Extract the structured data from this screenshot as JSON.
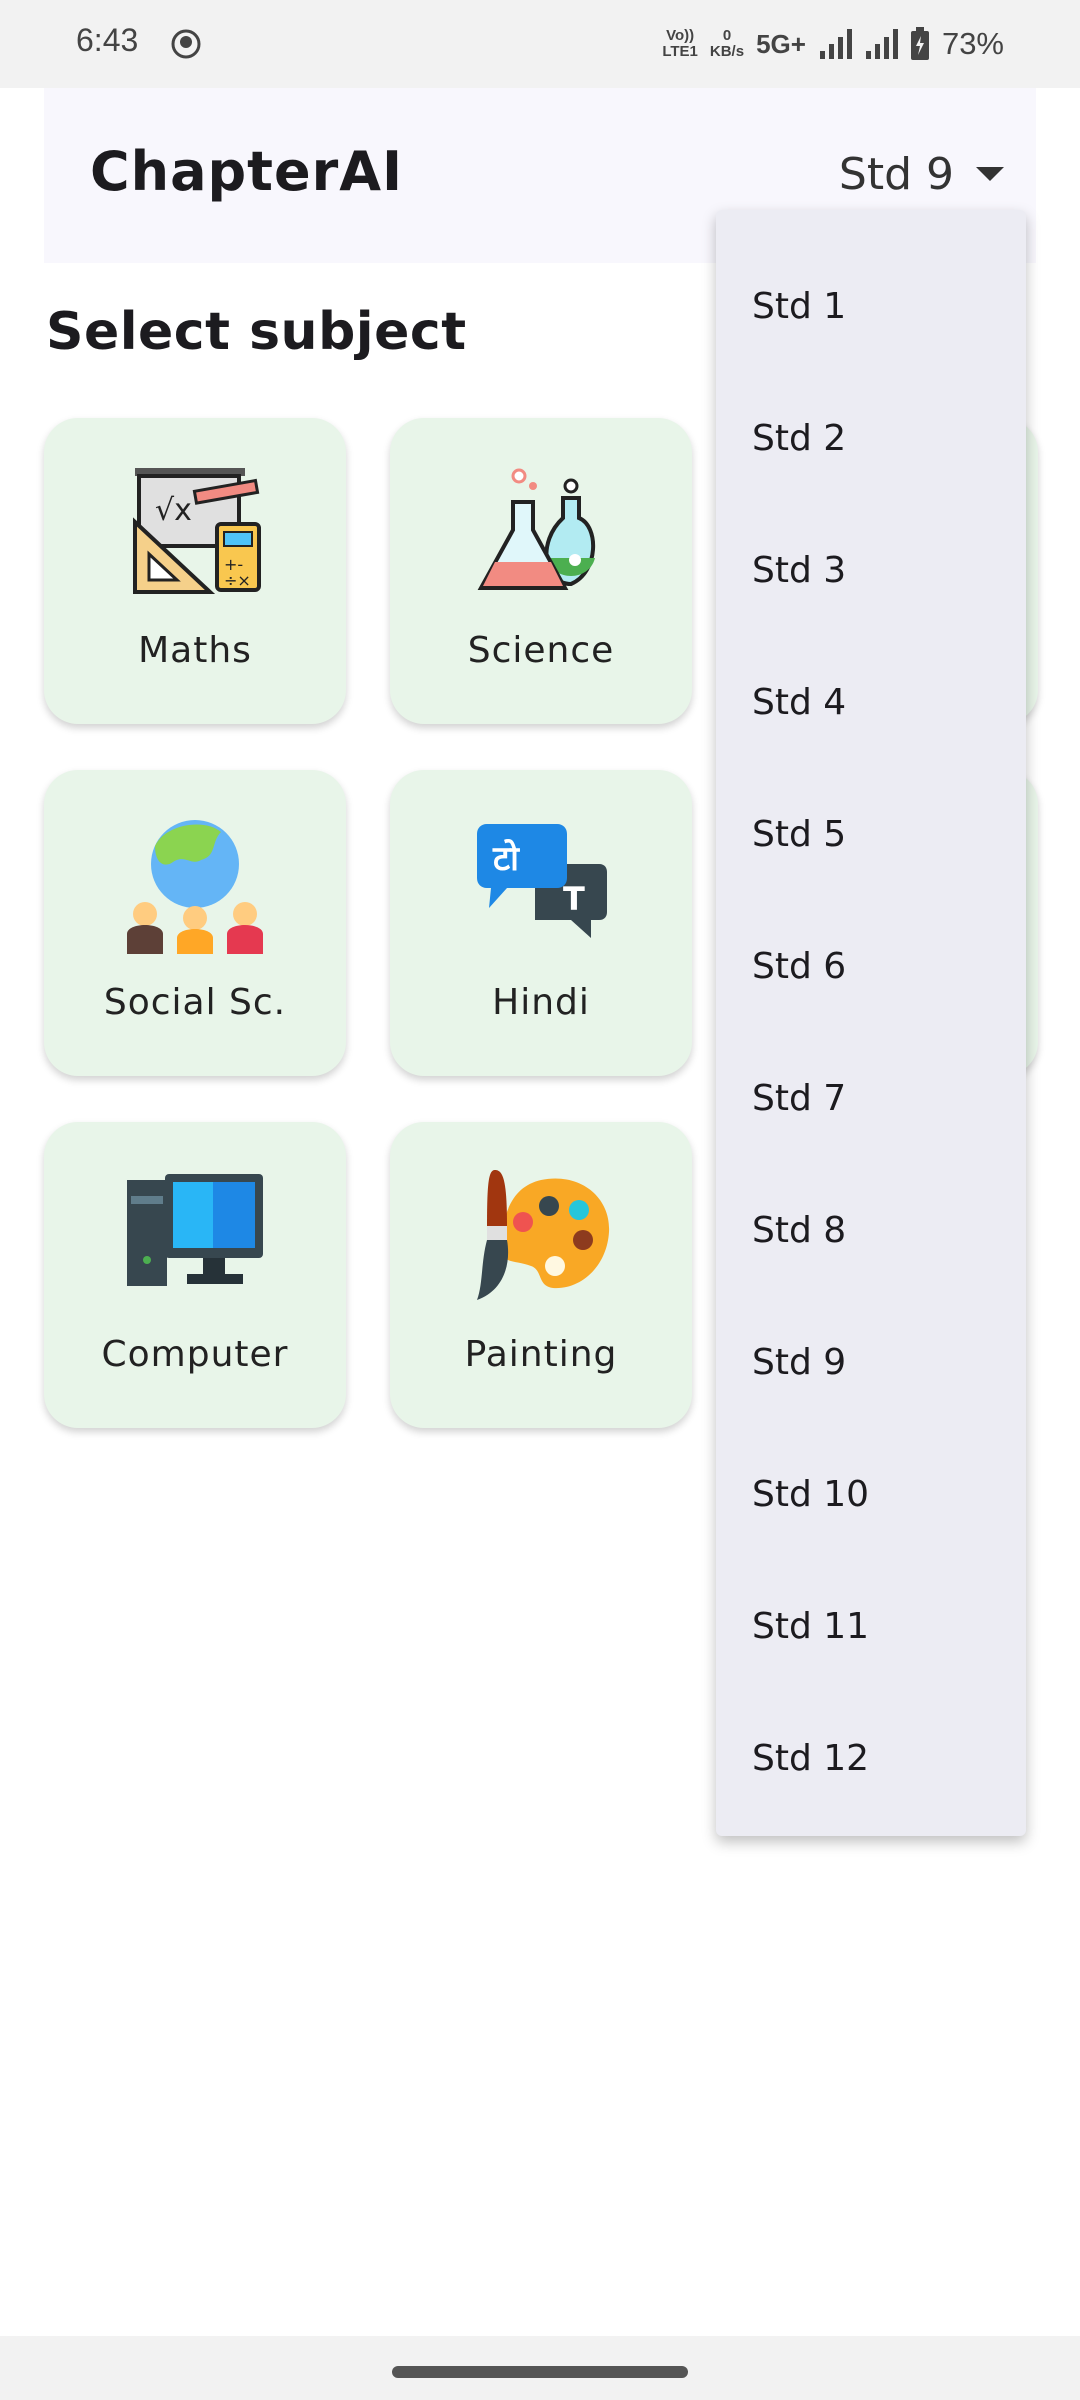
{
  "status_bar": {
    "time": "6:43",
    "volte": "Vo))",
    "lte": "LTE1",
    "speed_value": "0",
    "speed_unit": "KB/s",
    "network": "5G+",
    "battery": "73%"
  },
  "app_bar": {
    "title": "ChapterAI",
    "selected_std": "Std 9"
  },
  "section_title": "Select subject",
  "subjects": [
    {
      "label": "Maths",
      "icon": "maths-icon"
    },
    {
      "label": "Science",
      "icon": "science-icon"
    },
    {
      "label": "Social Sc.",
      "icon": "social-science-icon"
    },
    {
      "label": "Hindi",
      "icon": "hindi-icon"
    },
    {
      "label": "Computer",
      "icon": "computer-icon"
    },
    {
      "label": "Painting",
      "icon": "painting-icon"
    }
  ],
  "dropdown": {
    "options": [
      "Std 1",
      "Std 2",
      "Std 3",
      "Std 4",
      "Std 5",
      "Std 6",
      "Std 7",
      "Std 8",
      "Std 9",
      "Std 10",
      "Std 11",
      "Std 12"
    ]
  },
  "hindi_glyph": "टो",
  "hindi_glyph_t": "T",
  "colors": {
    "card_bg": "#e8f5e9",
    "app_bar_bg": "#f8f7fd",
    "dropdown_bg": "#ececf3"
  }
}
